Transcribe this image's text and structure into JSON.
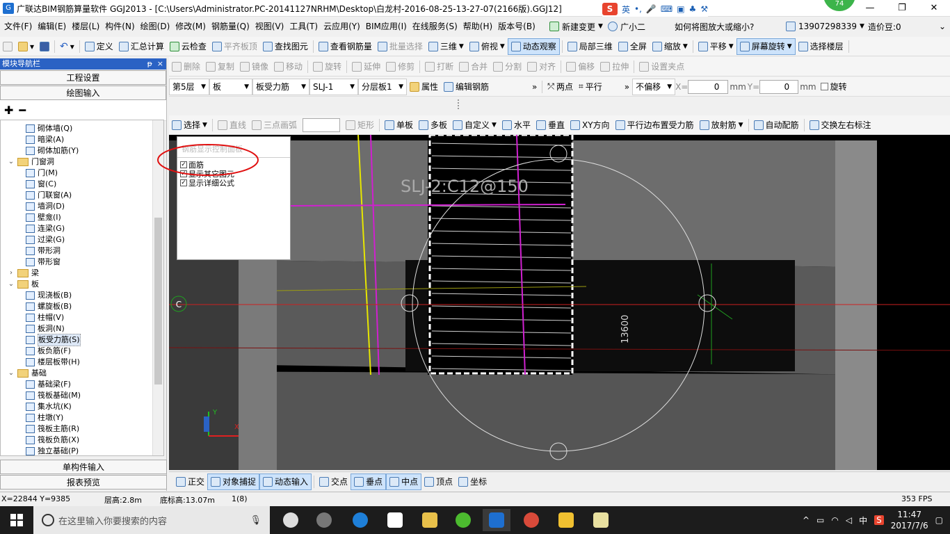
{
  "titlebar": {
    "title": "广联达BIM钢筋算量软件 GGJ2013 - [C:\\Users\\Administrator.PC-20141127NRHM\\Desktop\\白龙村-2016-08-25-13-27-07(2166版).GGJ12]",
    "ime_label": "英",
    "badge": "74",
    "min": "—",
    "max": "❐",
    "close": "✕"
  },
  "menu": {
    "items": [
      "文件(F)",
      "编辑(E)",
      "楼层(L)",
      "构件(N)",
      "绘图(D)",
      "修改(M)",
      "钢筋量(Q)",
      "视图(V)",
      "工具(T)",
      "云应用(Y)",
      "BIM应用(I)",
      "在线服务(S)",
      "帮助(H)",
      "版本号(B)"
    ],
    "new_change": "新建变更",
    "assistant": "广小二",
    "question": "如何将图放大或缩小?",
    "phone": "13907298339",
    "price": "造价豆:0"
  },
  "toolbar1": {
    "items": [
      "定义",
      "汇总计算",
      "云检查",
      "平齐板顶",
      "查找图元",
      "查看钢筋量",
      "批量选择",
      "三维",
      "俯视",
      "动态观察",
      "局部三维",
      "全屏",
      "缩放",
      "平移",
      "屏幕旋转",
      "选择楼层"
    ]
  },
  "toolbar2": {
    "items": [
      "删除",
      "复制",
      "镜像",
      "移动",
      "旋转",
      "延伸",
      "修剪",
      "打断",
      "合并",
      "分割",
      "对齐",
      "偏移",
      "拉伸",
      "设置夹点"
    ]
  },
  "toolbar3": {
    "floor": "第5层",
    "category": "板",
    "type": "板受力筋",
    "name": "SLJ-1",
    "layer": "分层板1",
    "props": "属性",
    "edit": "编辑钢筋",
    "twopoint": "两点",
    "parallel": "平行",
    "offset": "不偏移",
    "x_label": "X=",
    "x_val": "0",
    "y_label": "Y=",
    "y_val": "0",
    "unit": "mm",
    "rotate": "旋转"
  },
  "toolbar4": {
    "items": [
      "选择",
      "直线",
      "三点画弧",
      "矩形",
      "单板",
      "多板",
      "自定义",
      "水平",
      "垂直",
      "XY方向",
      "平行边布置受力筋",
      "放射筋",
      "自动配筋",
      "交换左右标注"
    ]
  },
  "leftpanel": {
    "title": "模块导航栏",
    "pin": "ᵽ",
    "close": "×",
    "btn_project": "工程设置",
    "btn_draw": "绘图输入",
    "btn_single": "单构件输入",
    "btn_report": "报表预览",
    "tree": [
      {
        "label": "砌体墙(Q)",
        "level": 2,
        "kind": "item"
      },
      {
        "label": "暗梁(A)",
        "level": 2,
        "kind": "item"
      },
      {
        "label": "砌体加筋(Y)",
        "level": 2,
        "kind": "item"
      },
      {
        "label": "门窗洞",
        "level": 1,
        "kind": "folder",
        "exp": "⌄"
      },
      {
        "label": "门(M)",
        "level": 2,
        "kind": "item"
      },
      {
        "label": "窗(C)",
        "level": 2,
        "kind": "item"
      },
      {
        "label": "门联窗(A)",
        "level": 2,
        "kind": "item"
      },
      {
        "label": "墙洞(D)",
        "level": 2,
        "kind": "item"
      },
      {
        "label": "壁龛(I)",
        "level": 2,
        "kind": "item"
      },
      {
        "label": "连梁(G)",
        "level": 2,
        "kind": "item"
      },
      {
        "label": "过梁(G)",
        "level": 2,
        "kind": "item"
      },
      {
        "label": "带形洞",
        "level": 2,
        "kind": "item"
      },
      {
        "label": "带形窗",
        "level": 2,
        "kind": "item"
      },
      {
        "label": "梁",
        "level": 1,
        "kind": "folder",
        "exp": "›"
      },
      {
        "label": "板",
        "level": 1,
        "kind": "folder",
        "exp": "⌄"
      },
      {
        "label": "现浇板(B)",
        "level": 2,
        "kind": "item"
      },
      {
        "label": "螺旋板(B)",
        "level": 2,
        "kind": "item"
      },
      {
        "label": "柱帽(V)",
        "level": 2,
        "kind": "item"
      },
      {
        "label": "板洞(N)",
        "level": 2,
        "kind": "item"
      },
      {
        "label": "板受力筋(S)",
        "level": 2,
        "kind": "item",
        "selected": true
      },
      {
        "label": "板负筋(F)",
        "level": 2,
        "kind": "item"
      },
      {
        "label": "楼层板带(H)",
        "level": 2,
        "kind": "item"
      },
      {
        "label": "基础",
        "level": 1,
        "kind": "folder",
        "exp": "⌄"
      },
      {
        "label": "基础梁(F)",
        "level": 2,
        "kind": "item"
      },
      {
        "label": "筏板基础(M)",
        "level": 2,
        "kind": "item"
      },
      {
        "label": "集水坑(K)",
        "level": 2,
        "kind": "item"
      },
      {
        "label": "柱墩(Y)",
        "level": 2,
        "kind": "item"
      },
      {
        "label": "筏板主筋(R)",
        "level": 2,
        "kind": "item"
      },
      {
        "label": "筏板负筋(X)",
        "level": 2,
        "kind": "item"
      },
      {
        "label": "独立基础(P)",
        "level": 2,
        "kind": "item"
      }
    ]
  },
  "ctrlpanel": {
    "header": "钢筋显示控制面板",
    "opts": [
      "面筋",
      "显示其它图元",
      "显示详细公式"
    ]
  },
  "canvas": {
    "rebar_label": "SLJ-2:C12@150",
    "dim": "13600",
    "axis_c": "C",
    "axis_y": "Y",
    "axis_x": "X"
  },
  "statusbar2": {
    "items": [
      "正交",
      "对象捕捉",
      "动态输入",
      "交点",
      "垂点",
      "中点",
      "顶点",
      "坐标"
    ]
  },
  "statusbar": {
    "coords": "X=22844 Y=9385",
    "height": "层高:2.8m",
    "base": "底标高:13.07m",
    "count": "1(8)",
    "fps": "353 FPS"
  },
  "taskbar": {
    "search": "在这里输入你要搜索的内容",
    "lang": "中",
    "time": "11:47",
    "date": "2017/7/6"
  },
  "colors": {
    "accent": "#2a62c4",
    "circle": "#e01010"
  }
}
